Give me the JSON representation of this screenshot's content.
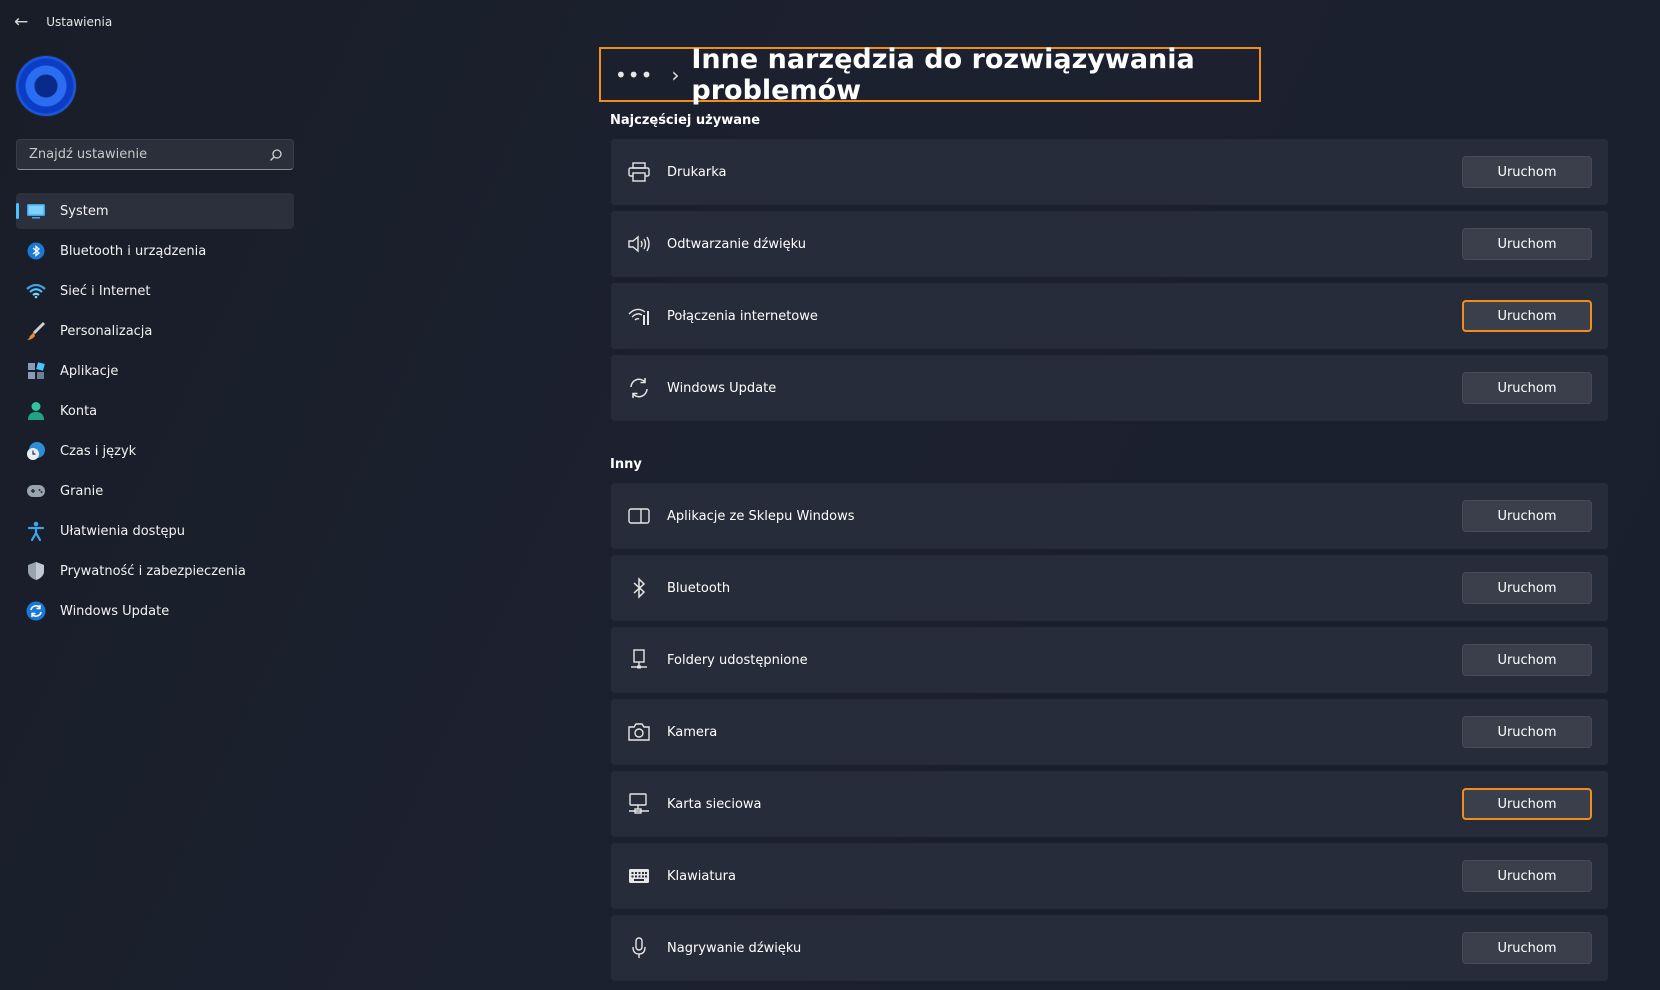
{
  "window": {
    "title": "Ustawienia"
  },
  "search": {
    "placeholder": "Znajdź ustawienie"
  },
  "sidebar": {
    "items": [
      {
        "label": "System",
        "active": true,
        "icon": "monitor-icon"
      },
      {
        "label": "Bluetooth i urządzenia",
        "icon": "bluetooth-icon"
      },
      {
        "label": "Sieć i Internet",
        "icon": "wifi-icon"
      },
      {
        "label": "Personalizacja",
        "icon": "brush-icon"
      },
      {
        "label": "Aplikacje",
        "icon": "apps-icon"
      },
      {
        "label": "Konta",
        "icon": "person-icon"
      },
      {
        "label": "Czas i język",
        "icon": "clock-globe-icon"
      },
      {
        "label": "Granie",
        "icon": "gamepad-icon"
      },
      {
        "label": "Ułatwienia dostępu",
        "icon": "accessibility-icon"
      },
      {
        "label": "Prywatność i zabezpieczenia",
        "icon": "shield-icon"
      },
      {
        "label": "Windows Update",
        "icon": "update-icon"
      }
    ]
  },
  "header": {
    "breadcrumb_more": "•••",
    "title": "Inne narzędzia do rozwiązywania problemów"
  },
  "sections": {
    "frequent": {
      "title": "Najczęściej używane",
      "items": [
        {
          "label": "Drukarka",
          "icon": "printer-icon",
          "button": "Uruchom"
        },
        {
          "label": "Odtwarzanie dźwięku",
          "icon": "speaker-icon",
          "button": "Uruchom"
        },
        {
          "label": "Połączenia internetowe",
          "icon": "wifi-signal-icon",
          "button": "Uruchom",
          "highlighted": true
        },
        {
          "label": "Windows Update",
          "icon": "sync-icon",
          "button": "Uruchom"
        }
      ]
    },
    "other": {
      "title": "Inny",
      "items": [
        {
          "label": "Aplikacje ze Sklepu Windows",
          "icon": "store-app-icon",
          "button": "Uruchom"
        },
        {
          "label": "Bluetooth",
          "icon": "bluetooth-icon",
          "button": "Uruchom"
        },
        {
          "label": "Foldery udostępnione",
          "icon": "network-share-icon",
          "button": "Uruchom"
        },
        {
          "label": "Kamera",
          "icon": "camera-icon",
          "button": "Uruchom"
        },
        {
          "label": "Karta sieciowa",
          "icon": "network-adapter-icon",
          "button": "Uruchom",
          "highlighted": true
        },
        {
          "label": "Klawiatura",
          "icon": "keyboard-icon",
          "button": "Uruchom"
        },
        {
          "label": "Nagrywanie dźwięku",
          "icon": "microphone-icon",
          "button": "Uruchom"
        }
      ]
    }
  },
  "colors": {
    "highlight": "#f28c1b",
    "accent": "#4cc2ff",
    "card": "#272c3a",
    "background": "#1b1f2b"
  }
}
